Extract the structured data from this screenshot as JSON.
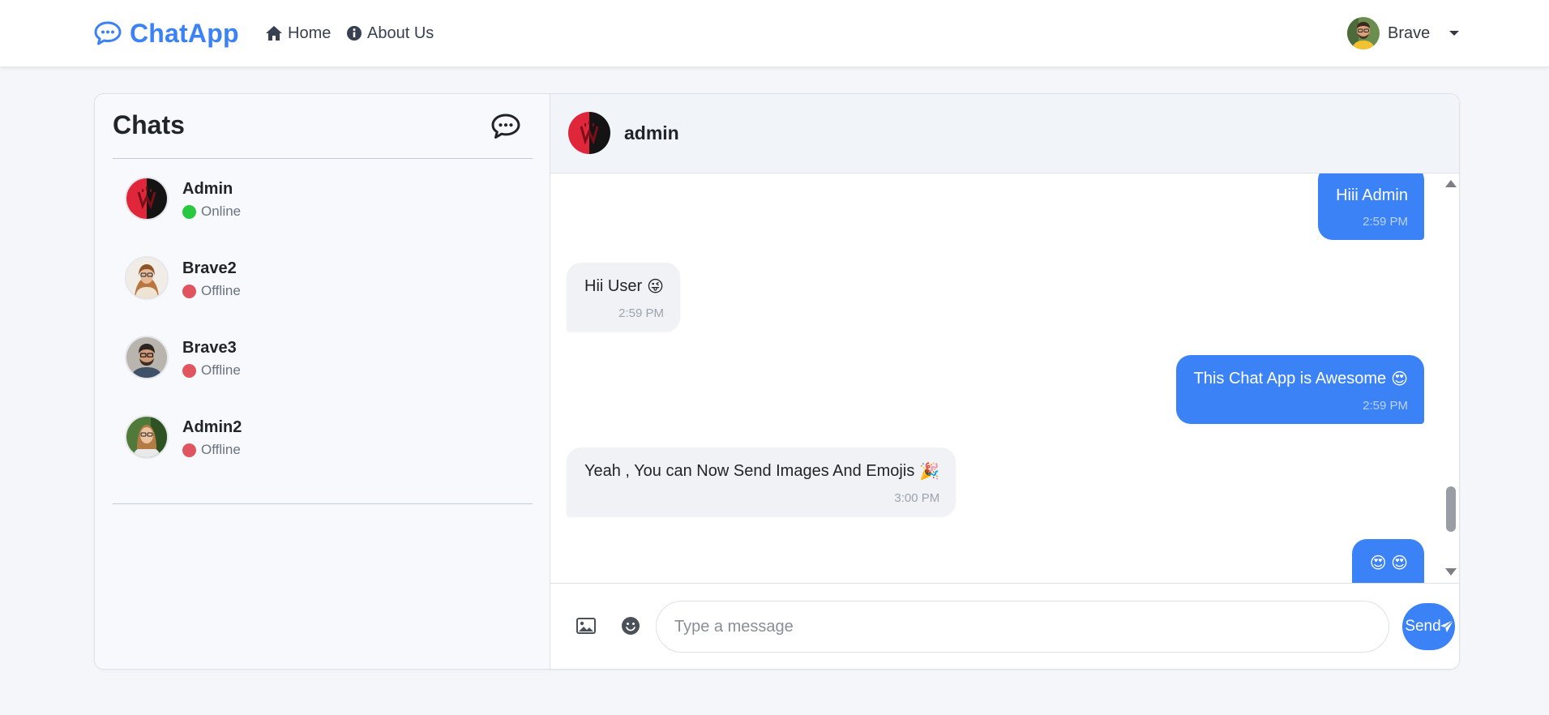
{
  "nav": {
    "brand": "ChatApp",
    "home": "Home",
    "about": "About Us",
    "user": "Brave"
  },
  "sidebar": {
    "title": "Chats",
    "chats": [
      {
        "name": "Admin",
        "status": "Online",
        "status_color": "#28c840"
      },
      {
        "name": "Brave2",
        "status": "Offline",
        "status_color": "#e0555f"
      },
      {
        "name": "Brave3",
        "status": "Offline",
        "status_color": "#e0555f"
      },
      {
        "name": "Admin2",
        "status": "Offline",
        "status_color": "#e0555f"
      }
    ]
  },
  "chat": {
    "title": "admin",
    "messages": [
      {
        "from": "me",
        "text": "Hiii Admin",
        "emoji": "",
        "time": "2:59 PM"
      },
      {
        "from": "them",
        "text": "Hii User",
        "emoji": "😜",
        "time": "2:59 PM"
      },
      {
        "from": "me",
        "text": "This Chat App is Awesome",
        "emoji": "😍",
        "time": "2:59 PM"
      },
      {
        "from": "them",
        "text": "Yeah , You can Now Send Images And Emojis",
        "emoji": "🎉",
        "time": "3:00 PM"
      },
      {
        "from": "me",
        "text": "",
        "emoji": "😍 😍",
        "time": ""
      }
    ],
    "input_placeholder": "Type a message",
    "send_label": "Send"
  },
  "colors": {
    "accent": "#3b82f6",
    "online": "#28c840",
    "offline": "#e0555f"
  },
  "icons": [
    "chat-bubble-icon",
    "home-icon",
    "info-icon",
    "new-chat-icon",
    "image-icon",
    "emoji-icon",
    "paper-plane-icon"
  ]
}
